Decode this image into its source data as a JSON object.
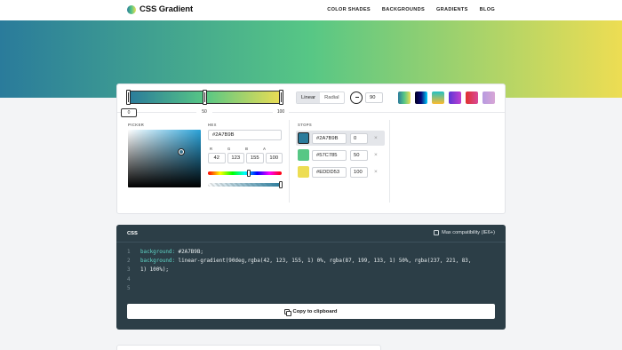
{
  "header": {
    "logo_text": "CSS Gradient",
    "nav": [
      "COLOR SHADES",
      "BACKGROUNDS",
      "GRADIENTS",
      "BLOG"
    ]
  },
  "gradient": {
    "stop_labels": [
      "0",
      "50",
      "100"
    ],
    "type_options": [
      "Linear",
      "Radial"
    ],
    "selected_type": "Linear",
    "angle": "90",
    "presets": [
      {
        "name": "preset-teal-green",
        "from": "#2A7B9B",
        "to": "#EDDD53"
      },
      {
        "name": "preset-navy",
        "from": "#0a1a3a",
        "to": "#1e3a8a"
      },
      {
        "name": "preset-green-yellow",
        "from": "#34b89a",
        "to": "#e6d85a"
      },
      {
        "name": "preset-purple",
        "from": "#6c3fd6",
        "to": "#c24fd0"
      },
      {
        "name": "preset-red-pink",
        "from": "#e0302d",
        "to": "#d94a9a"
      },
      {
        "name": "preset-lavender",
        "from": "#b79ae0",
        "to": "#d6a8d8"
      }
    ]
  },
  "picker": {
    "label": "PICKER",
    "hex_label": "HEX",
    "hex_value": "#2A7B9B",
    "rgba_labels": [
      "R",
      "G",
      "B",
      "A"
    ],
    "rgba_values": [
      "42",
      "123",
      "155",
      "100"
    ]
  },
  "stops": {
    "label": "STOPS",
    "items": [
      {
        "hex": "#2A7B9B",
        "position": "0",
        "color": "#2A7B9B",
        "active": true
      },
      {
        "hex": "#57C785",
        "position": "50",
        "color": "#57C785",
        "active": false
      },
      {
        "hex": "#EDDD53",
        "position": "100",
        "color": "#EDDD53",
        "active": false
      }
    ],
    "remove_glyph": "×"
  },
  "code": {
    "title": "CSS",
    "compat_label": "Max compatibility (IE6+)",
    "line_numbers": [
      "1",
      "2",
      "3",
      "4",
      "5"
    ],
    "line1_prop": "background:",
    "line1_value": " #2A7B9B;",
    "line2_prop": "background:",
    "line2_value": " linear-gradient(90deg,rgba(42, 123, 155, 1) 0%, rgba(87, 199, 133, 1) 50%, rgba(237, 221, 83,",
    "line3_value": "1) 100%);",
    "copy_label": "Copy to clipboard"
  }
}
